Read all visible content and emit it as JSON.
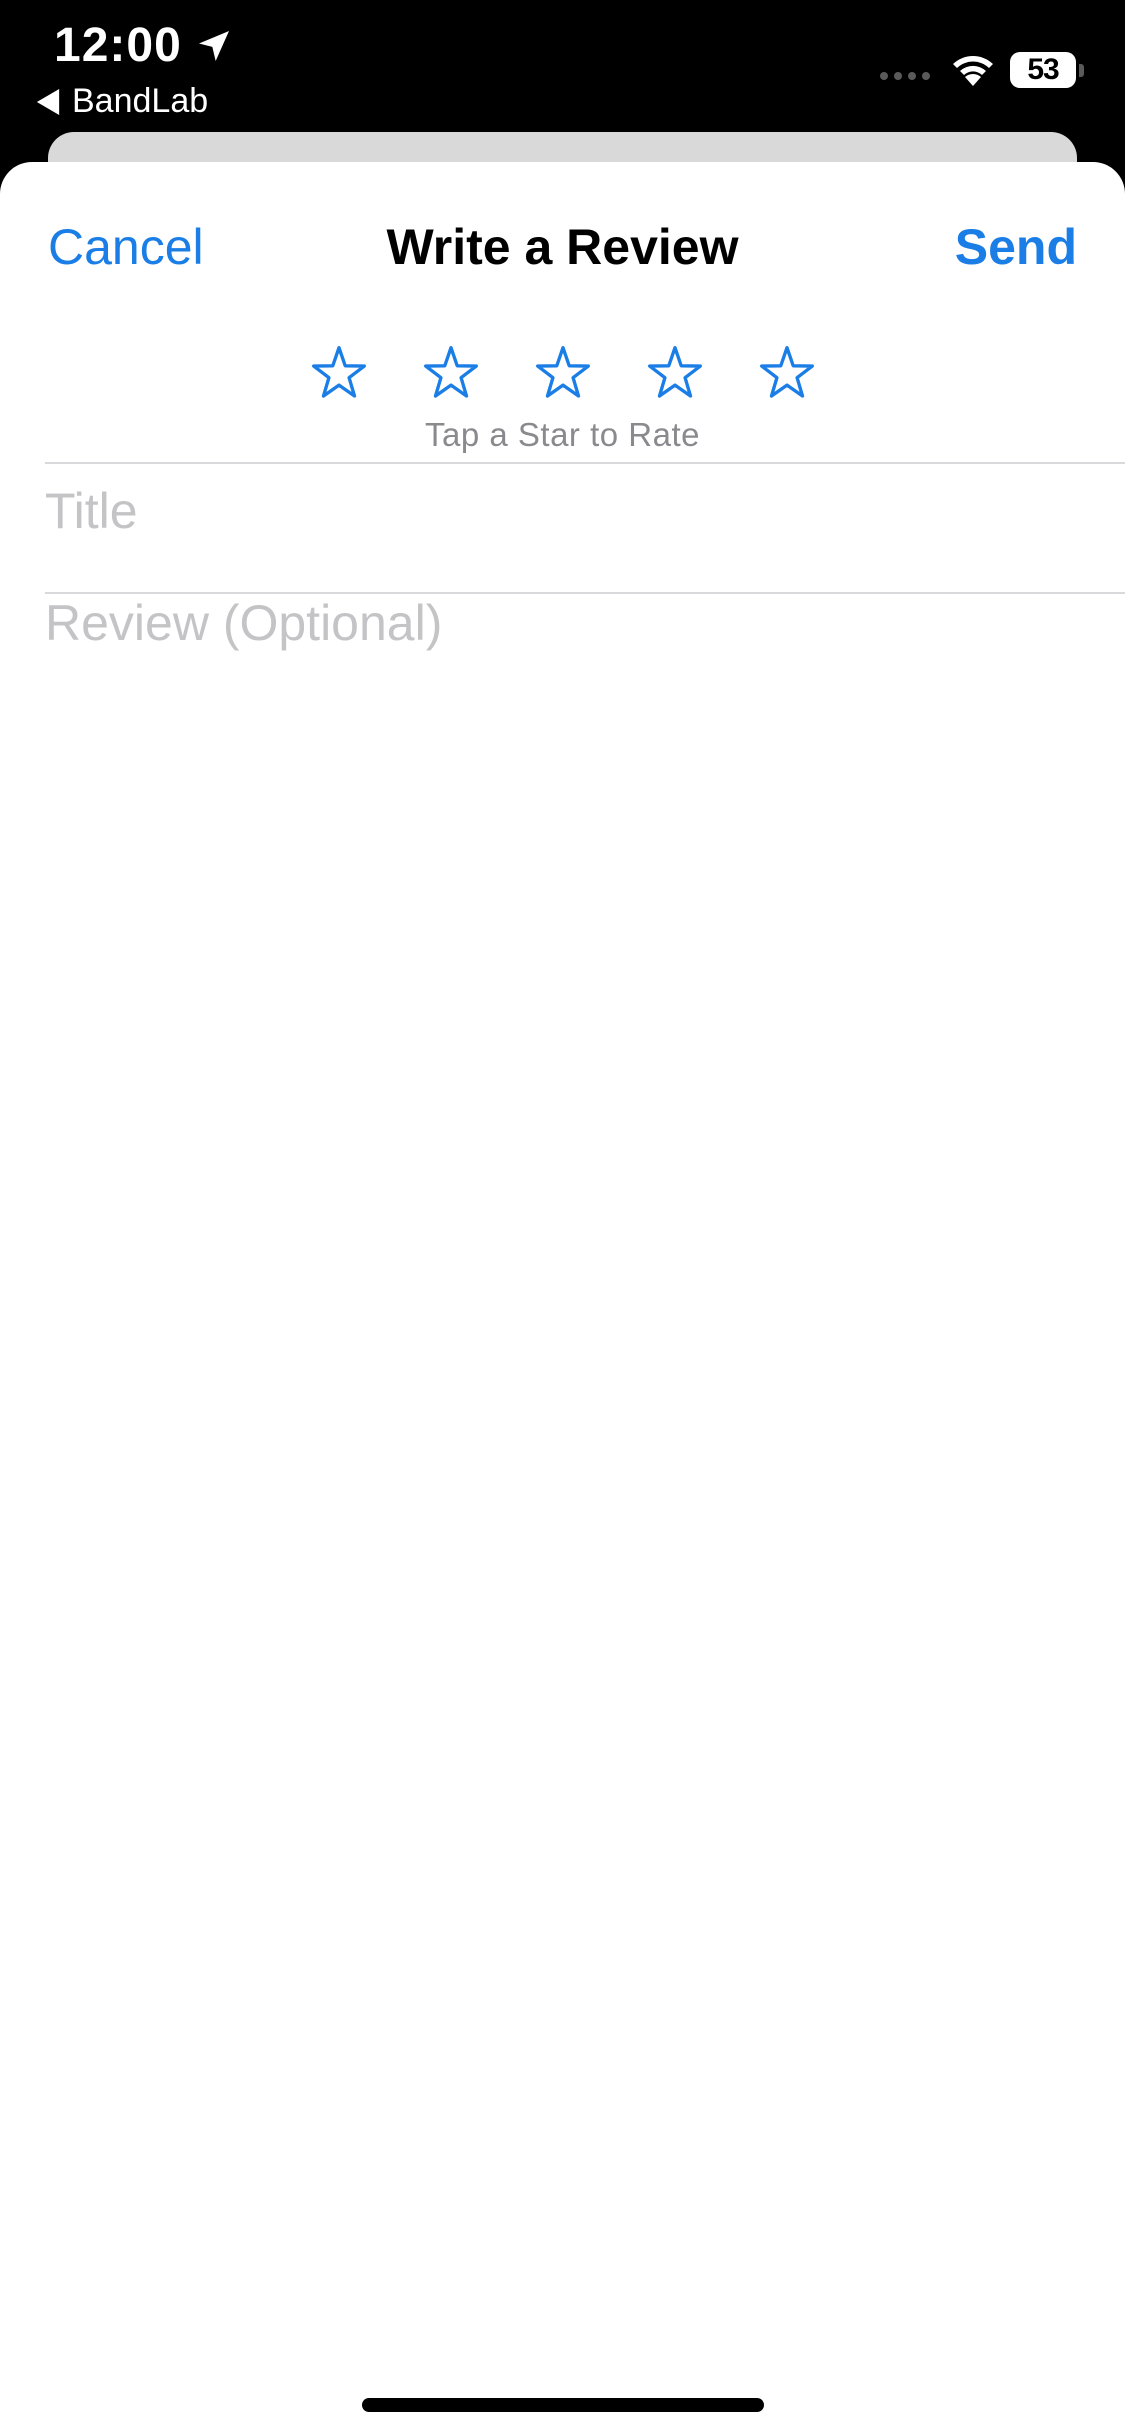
{
  "status_bar": {
    "time": "12:00",
    "back_app": "BandLab",
    "battery": "53"
  },
  "nav": {
    "cancel_label": "Cancel",
    "title": "Write a Review",
    "send_label": "Send"
  },
  "rating": {
    "stars": 5,
    "selected": 0,
    "hint": "Tap a Star to Rate"
  },
  "form": {
    "title_placeholder": "Title",
    "review_placeholder": "Review (Optional)"
  },
  "colors": {
    "accent": "#1a7ee6",
    "placeholder": "#c4c4c7"
  }
}
